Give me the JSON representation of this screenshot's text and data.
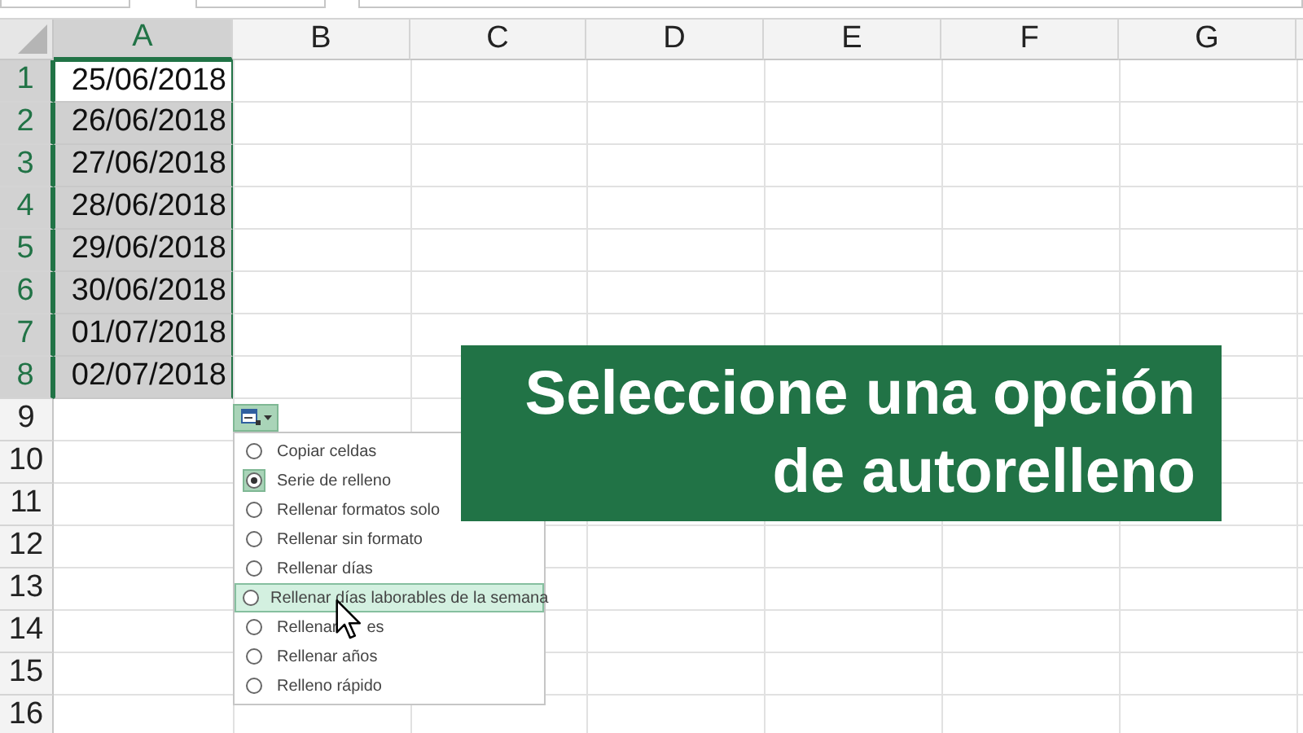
{
  "columns": [
    {
      "label": "A",
      "selected": true
    },
    {
      "label": "B",
      "selected": false
    },
    {
      "label": "C",
      "selected": false
    },
    {
      "label": "D",
      "selected": false
    },
    {
      "label": "E",
      "selected": false
    },
    {
      "label": "F",
      "selected": false
    },
    {
      "label": "G",
      "selected": false
    }
  ],
  "rows": [
    {
      "number": "1",
      "value": "25/06/2018",
      "selected": true,
      "active": true
    },
    {
      "number": "2",
      "value": "26/06/2018",
      "selected": true,
      "active": false
    },
    {
      "number": "3",
      "value": "27/06/2018",
      "selected": true,
      "active": false
    },
    {
      "number": "4",
      "value": "28/06/2018",
      "selected": true,
      "active": false
    },
    {
      "number": "5",
      "value": "29/06/2018",
      "selected": true,
      "active": false
    },
    {
      "number": "6",
      "value": "30/06/2018",
      "selected": true,
      "active": false
    },
    {
      "number": "7",
      "value": "01/07/2018",
      "selected": true,
      "active": false
    },
    {
      "number": "8",
      "value": "02/07/2018",
      "selected": true,
      "active": false
    },
    {
      "number": "9",
      "selected": false
    },
    {
      "number": "10",
      "selected": false
    },
    {
      "number": "11",
      "selected": false
    },
    {
      "number": "12",
      "selected": false
    },
    {
      "number": "13",
      "selected": false
    },
    {
      "number": "14",
      "selected": false
    },
    {
      "number": "15",
      "selected": false
    },
    {
      "number": "16",
      "selected": false
    }
  ],
  "autofill_menu": {
    "items": [
      {
        "label": "Copiar celdas",
        "selected": false,
        "highlighted": false
      },
      {
        "label": "Serie de relleno",
        "selected": true,
        "highlighted": false
      },
      {
        "label": "Rellenar formatos solo",
        "selected": false,
        "highlighted": false
      },
      {
        "label": "Rellenar sin formato",
        "selected": false,
        "highlighted": false
      },
      {
        "label": "Rellenar días",
        "selected": false,
        "highlighted": false
      },
      {
        "label": "Rellenar días laborables de la semana",
        "selected": false,
        "highlighted": true
      },
      {
        "label": "Rellenar",
        "label_tail": "es",
        "selected": false,
        "highlighted": false
      },
      {
        "label": "Rellenar años",
        "selected": false,
        "highlighted": false
      },
      {
        "label": "Relleno rápido",
        "selected": false,
        "highlighted": false
      }
    ]
  },
  "banner": {
    "lines": [
      "Seleccione una opción",
      "de autorelleno"
    ]
  }
}
